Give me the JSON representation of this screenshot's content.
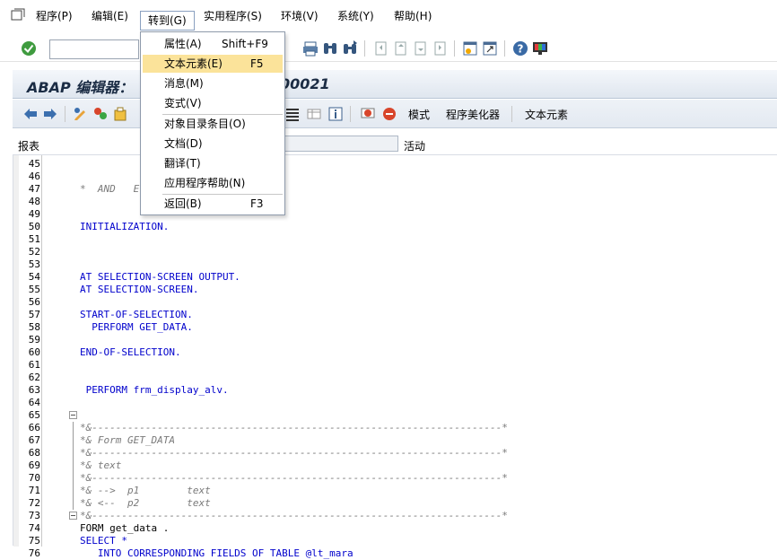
{
  "menubar": {
    "items": [
      "程序(P)",
      "编辑(E)",
      "转到(G)",
      "实用程序(S)",
      "环境(V)",
      "系统(Y)",
      "帮助(H)"
    ]
  },
  "title": {
    "left": "ABAP 编辑器：",
    "right": "00021"
  },
  "app_toolbar": {
    "mode": "模式",
    "pretty_printer": "程序美化器",
    "text_elements": "文本元素"
  },
  "field_row": {
    "label": "报表",
    "status": "活动"
  },
  "goto_menu": {
    "items": [
      {
        "label": "属性(A)",
        "shortcut": "Shift+F9"
      },
      {
        "label": "文本元素(E)",
        "shortcut": "F5"
      },
      {
        "label": "消息(M)",
        "shortcut": ""
      },
      {
        "label": "变式(V)",
        "shortcut": ""
      },
      {
        "label": "对象目录条目(O)",
        "shortcut": ""
      },
      {
        "label": "文档(D)",
        "shortcut": ""
      },
      {
        "label": "翻译(T)",
        "shortcut": ""
      },
      {
        "label": "应用程序帮助(N)",
        "shortcut": ""
      },
      {
        "label": "返回(B)",
        "shortcut": "F3"
      }
    ],
    "highlighted": "文本元素(E)"
  },
  "colors": {
    "highlight": "#fbe39a",
    "keyword": "#0000cc",
    "comment": "#7a7a7a"
  },
  "code_lines": [
    {
      "n": "45",
      "t": ""
    },
    {
      "n": "46",
      "t": ""
    },
    {
      "n": "47",
      "t": "*  AND   E"
    },
    {
      "n": "48",
      "t": ""
    },
    {
      "n": "49",
      "t": ""
    },
    {
      "n": "50",
      "t": "INITIALIZATION."
    },
    {
      "n": "51",
      "t": ""
    },
    {
      "n": "52",
      "t": ""
    },
    {
      "n": "53",
      "t": ""
    },
    {
      "n": "54",
      "t": "AT SELECTION-SCREEN OUTPUT."
    },
    {
      "n": "55",
      "t": "AT SELECTION-SCREEN."
    },
    {
      "n": "56",
      "t": ""
    },
    {
      "n": "57",
      "t": "START-OF-SELECTION."
    },
    {
      "n": "58",
      "t": "  PERFORM GET_DATA."
    },
    {
      "n": "59",
      "t": ""
    },
    {
      "n": "60",
      "t": "END-OF-SELECTION."
    },
    {
      "n": "61",
      "t": ""
    },
    {
      "n": "62",
      "t": ""
    },
    {
      "n": "63",
      "t": " PERFORM frm_display_alv."
    },
    {
      "n": "64",
      "t": ""
    },
    {
      "n": "65",
      "t": ""
    },
    {
      "n": "66",
      "t": "*&---------------------------------------------------------------------*"
    },
    {
      "n": "67",
      "t": "*& Form GET_DATA"
    },
    {
      "n": "68",
      "t": "*&---------------------------------------------------------------------*"
    },
    {
      "n": "69",
      "t": "*& text"
    },
    {
      "n": "70",
      "t": "*&---------------------------------------------------------------------*"
    },
    {
      "n": "71",
      "t": "*& -->  p1        text"
    },
    {
      "n": "72",
      "t": "*& <--  p2        text"
    },
    {
      "n": "73",
      "t": "*&---------------------------------------------------------------------*"
    },
    {
      "n": "74",
      "t": "FORM get_data ."
    },
    {
      "n": "75",
      "t": "SELECT *"
    },
    {
      "n": "76",
      "t": "   INTO CORRESPONDING FIELDS OF TABLE @lt_mara"
    }
  ]
}
